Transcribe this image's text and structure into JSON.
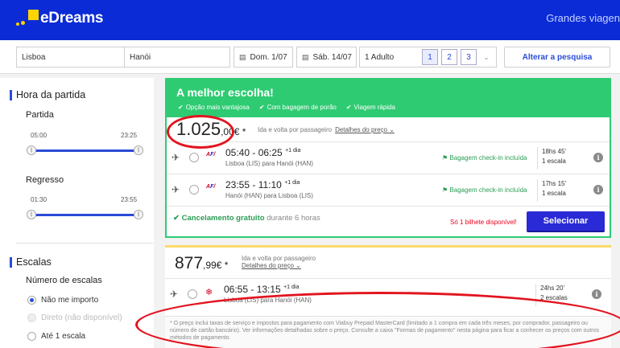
{
  "header": {
    "brand": "eDreams",
    "right_link": "Grandes viagen"
  },
  "search": {
    "origin": "Lisboa",
    "destination": "Hanói",
    "depart_date": "Dom. 1/07",
    "return_date": "Sáb. 14/07",
    "passengers": "1 Adulto",
    "pax_options": [
      "1",
      "2",
      "3"
    ],
    "alter_label": "Alterar a pesquisa"
  },
  "sidebar": {
    "departure_time_title": "Hora da partida",
    "outbound_label": "Partida",
    "outbound_min": "05:00",
    "outbound_max": "23:25",
    "return_label": "Regresso",
    "return_min": "01:30",
    "return_max": "23:55",
    "stops_title": "Escalas",
    "stops_label": "Número de escalas",
    "stop_options": [
      "Não me importo",
      "Direto (não disponível)",
      "Até 1 escala"
    ]
  },
  "best": {
    "title": "A melhor escolha!",
    "features": [
      "Opção mais vantajosa",
      "Com bagagem de porão",
      "Viagem rápida"
    ],
    "price_main": "1.025",
    "price_dec": ",00€ *",
    "price_note": "Ida e volta por passageiro",
    "details_link": "Detalhes do preço",
    "legs": [
      {
        "times": "05:40 - 06:25",
        "day_offset": "+1 dia",
        "route": "Lisboa (LIS) para Hanói (HAN)",
        "baggage": "Bagagem check-in incluída",
        "duration": "18hs 45'",
        "stops": "1 escala"
      },
      {
        "times": "23:55 - 11:10",
        "day_offset": "+1 dia",
        "route": "Hanói (HAN) para Lisboa (LIS)",
        "baggage": "Bagagem check-in incluída",
        "duration": "17hs 15'",
        "stops": "1 escala"
      }
    ],
    "free_cancel": "Cancelamento gratuito",
    "free_cancel_rest": "durante 6 horas",
    "last_seat": "Só 1 bilhete disponível!",
    "select_label": "Selecionar"
  },
  "second": {
    "price_main": "877",
    "price_dec": ",99€ *",
    "price_note": "Ida e volta por passageiro",
    "details_link": "Detalhes do preço",
    "leg": {
      "times": "06:55 - 13:15",
      "day_offset": "+1 dia",
      "route": "Lisboa (LIS) para Hanói (HAN)",
      "duration": "24hs 20'",
      "stops": "2 escalas"
    }
  },
  "disclaimer": "* O preço inclui taxas de serviço e impostos para pagamento com Viabuy Prepaid MasterCard (limitado a 1 compra em cada três meses, por comprador, passageiro ou número de cartão bancário). Ver informações detalhadas sobre o preço. Consulte a caixa \"Formas de pagamento\" nesta página para ficar a conhecer os preços com outros métodos de pagamento.",
  "colors": {
    "header_blue": "#0a2bd6",
    "best_green": "#2fcb72",
    "select_button": "#2a2ad6",
    "annotation_red": "#e2141f",
    "logo_yellow": "#ffd400"
  }
}
